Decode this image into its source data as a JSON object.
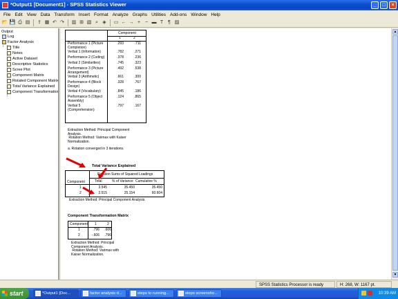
{
  "window": {
    "title": "*Output1 [Document1] - SPSS Statistics Viewer"
  },
  "menu": [
    "File",
    "Edit",
    "View",
    "Data",
    "Transform",
    "Insert",
    "Format",
    "Analyze",
    "Graphs",
    "Utilities",
    "Add-ons",
    "Window",
    "Help"
  ],
  "toolbar_icons": [
    "open-icon",
    "save-icon",
    "print-icon",
    "print-preview-icon",
    "export-icon",
    "recall-dialog-icon",
    "undo-icon",
    "redo-icon",
    "goto-data-icon",
    "goto-case-icon",
    "variables-icon",
    "find-icon",
    "designate-window-icon",
    "select-icon",
    "promote-icon",
    "demote-icon",
    "show-icon",
    "hide-icon",
    "insert-heading-icon",
    "insert-title-icon",
    "insert-text-icon",
    "insert-chart-icon"
  ],
  "outline": {
    "root": "Output",
    "items": [
      {
        "label": "Log",
        "level": 1,
        "kind": "book"
      },
      {
        "label": "Factor Analysis",
        "level": 1,
        "kind": "folder"
      },
      {
        "label": "Title",
        "level": 2,
        "kind": "page"
      },
      {
        "label": "Notes",
        "level": 2,
        "kind": "page"
      },
      {
        "label": "Active Dataset",
        "level": 2,
        "kind": "page"
      },
      {
        "label": "Descriptive Statistics",
        "level": 2,
        "kind": "page"
      },
      {
        "label": "Scree Plot",
        "level": 2,
        "kind": "page"
      },
      {
        "label": "Component Matrix",
        "level": 2,
        "kind": "page"
      },
      {
        "label": "Rotated Component Matrix",
        "level": 2,
        "kind": "page"
      },
      {
        "label": "Total Variance Explained",
        "level": 2,
        "kind": "page"
      },
      {
        "label": "Component Transformation",
        "level": 2,
        "kind": "page"
      }
    ]
  },
  "rotated_matrix": {
    "header": "Component",
    "cols": [
      "1",
      "2"
    ],
    "rows": [
      {
        "label": "Performance 1 (Picture Completion)",
        "v": [
          ".293",
          ".711"
        ]
      },
      {
        "label": "Verbal 1 (Information)",
        "v": [
          ".782",
          ".271"
        ]
      },
      {
        "label": "Performance 2 (Coding)",
        "v": [
          ".378",
          ".236"
        ]
      },
      {
        "label": "Verbal 2 (Similarities)",
        "v": [
          ".745",
          ".323"
        ]
      },
      {
        "label": "Performance 3 (Picture Arrangement)",
        "v": [
          ".492",
          ".538"
        ]
      },
      {
        "label": "Verbal 3 (Arithmetic)",
        "v": [
          ".661",
          ".300"
        ]
      },
      {
        "label": "Performance 4 (Block Design)",
        "v": [
          ".328",
          ".767"
        ]
      },
      {
        "label": "Verbal 4 (Vocabulary)",
        "v": [
          ".845",
          ".186"
        ]
      },
      {
        "label": "Performance 5 (Object Assembly)",
        "v": [
          ".124",
          ".865"
        ]
      },
      {
        "label": "Verbal 5 (Comprehension)",
        "v": [
          ".797",
          ".167"
        ]
      }
    ],
    "footnote": "Extraction Method: Principal Component\nAnalysis.\n Rotation Method: Varimax with Kaiser\nNormalization.",
    "footnote_a": "a. Rotation converged in 3 iterations."
  },
  "variance": {
    "title": "Total Variance Explained",
    "group_header": "Rotation Sums of Squared Loadings",
    "row_header": "Component",
    "cols": [
      "Total",
      "% of Variance",
      "Cumulative %"
    ],
    "rows": [
      {
        "c": "1",
        "v": [
          "3.545",
          "35.450",
          "35.450"
        ]
      },
      {
        "c": "2",
        "v": [
          "2.515",
          "25.154",
          "60.604"
        ]
      }
    ],
    "footnote": "Extraction Method: Principal Component Analysis."
  },
  "transformation": {
    "title": "Component Transformation Matrix",
    "row_header": "Component",
    "cols": [
      "1",
      "2"
    ],
    "rows": [
      {
        "c": "1",
        "v": [
          ".796",
          ".606"
        ]
      },
      {
        "c": "2",
        "v": [
          "-.606",
          ".796"
        ]
      }
    ],
    "footnote": "Extraction Method: Principal\nComponent Analysis.\n Rotation Method: Varimax with\nKaiser Normalization."
  },
  "status": {
    "processor": "SPSS Statistics  Processor is ready",
    "size": "H: 268, W: 1167 pt."
  },
  "taskbar": {
    "start": "start",
    "tasks": [
      "*Output1 [Doc...",
      "factor analysis d...",
      "steps to running...",
      "steps screensho..."
    ],
    "clock": "10:39 AM"
  },
  "colors": {
    "title_bar": "#0a4fd0",
    "annotation_arrow": "#e00000",
    "taskbar": "#245edb",
    "start_button": "#3c8f35"
  }
}
